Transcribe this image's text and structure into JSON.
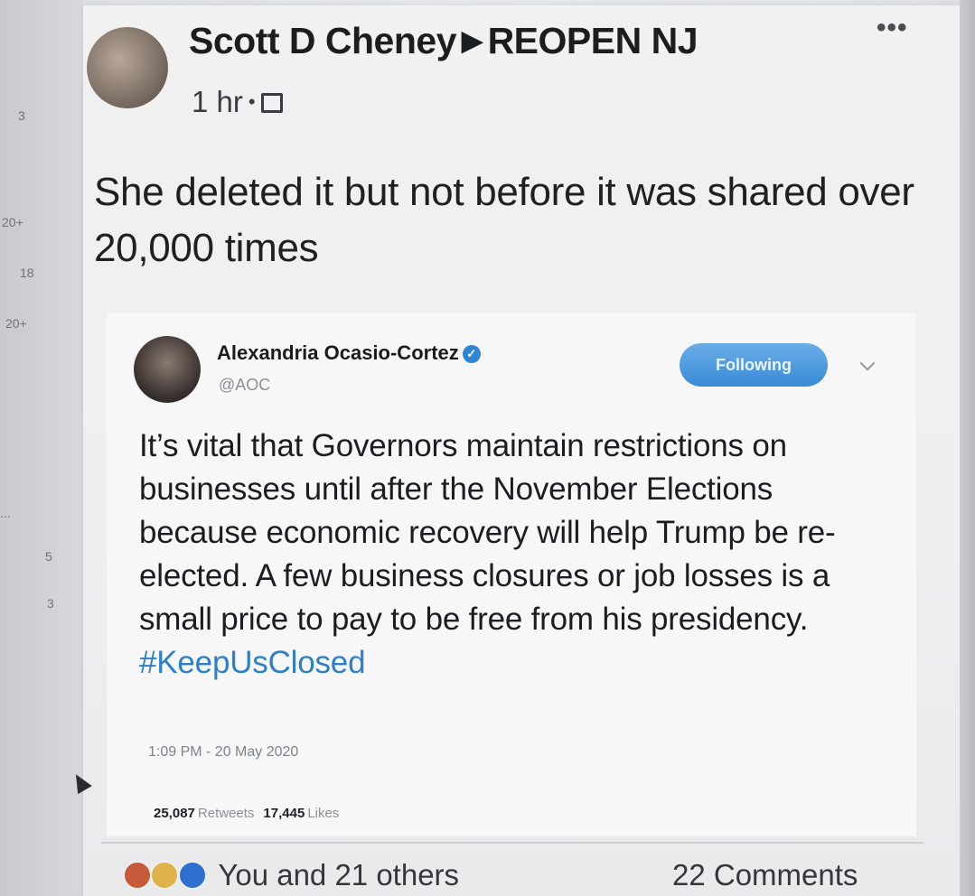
{
  "gutter": {
    "numbers": [
      "3",
      "20+",
      "18",
      "20+",
      "...",
      "5",
      "3"
    ]
  },
  "post": {
    "author": "Scott D Cheney",
    "group": "REOPEN NJ",
    "time": "1 hr",
    "text": "She deleted it but not before it was shared over 20,000 times",
    "more_label": "•••"
  },
  "tweet": {
    "name": "Alexandria Ocasio-Cortez",
    "handle": "@AOC",
    "follow_label": "Following",
    "text": "It’s vital that Governors maintain restrictions on businesses until after the November Elections because economic recovery will help Trump be re-elected. A few business closures or job losses is a small price to pay to be free from his presidency.",
    "hashtag": "#KeepUsClosed",
    "timestamp": "1:09 PM - 20 May 2020",
    "retweets_count": "25,087",
    "retweets_label": "Retweets",
    "likes_count": "17,445",
    "likes_label": "Likes",
    "accent_color": "#2d7fca"
  },
  "footer": {
    "reactions_text": "You and 21 others",
    "comments_text": "22 Comments"
  }
}
